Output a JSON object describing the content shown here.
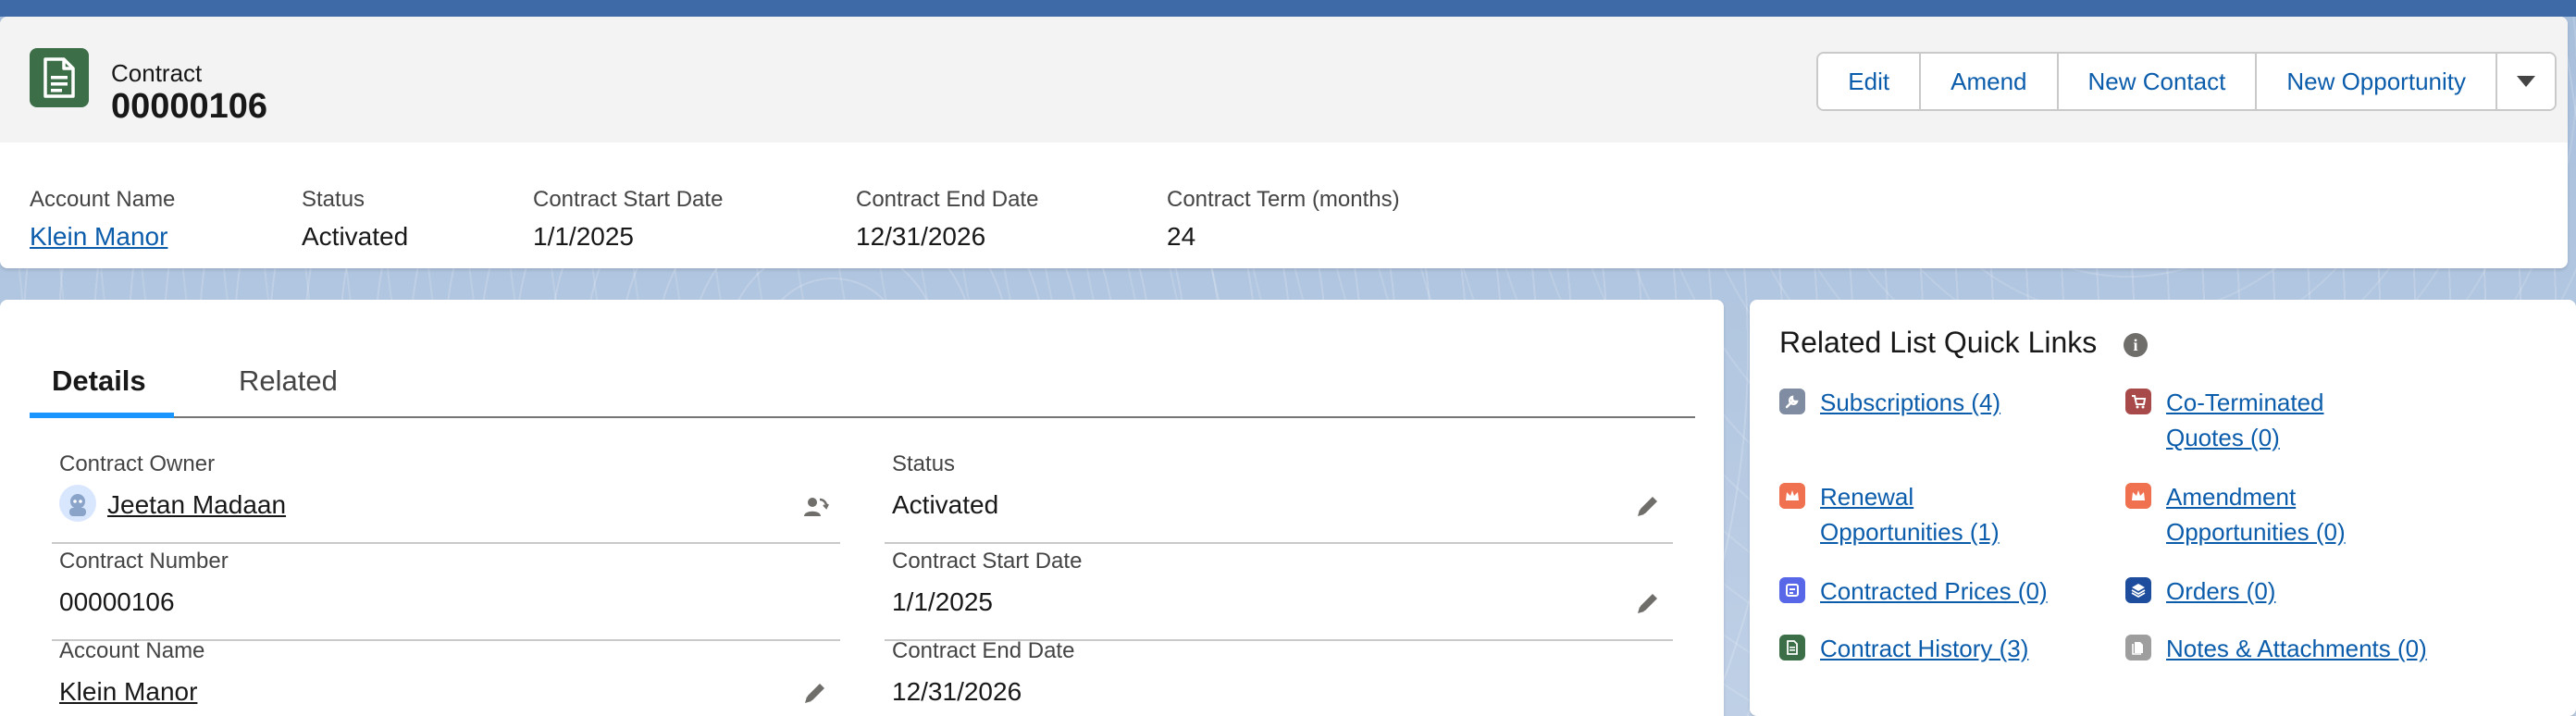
{
  "header": {
    "object_label": "Contract",
    "record_title": "00000106",
    "actions": {
      "edit": "Edit",
      "amend": "Amend",
      "new_contact": "New Contact",
      "new_opportunity": "New Opportunity"
    }
  },
  "highlights": [
    {
      "label": "Account Name",
      "value": "Klein Manor"
    },
    {
      "label": "Status",
      "value": "Activated"
    },
    {
      "label": "Contract Start Date",
      "value": "1/1/2025"
    },
    {
      "label": "Contract End Date",
      "value": "12/31/2026"
    },
    {
      "label": "Contract Term (months)",
      "value": "24"
    }
  ],
  "tabs": {
    "details": "Details",
    "related": "Related"
  },
  "details": {
    "contract_owner": {
      "label": "Contract Owner",
      "value": "Jeetan Madaan"
    },
    "status": {
      "label": "Status",
      "value": "Activated"
    },
    "contract_number": {
      "label": "Contract Number",
      "value": "00000106"
    },
    "start_date": {
      "label": "Contract Start Date",
      "value": "1/1/2025"
    },
    "account_name": {
      "label": "Account Name",
      "value": "Klein Manor"
    },
    "end_date": {
      "label": "Contract End Date",
      "value": "12/31/2026"
    }
  },
  "quick_links": {
    "title": "Related List Quick Links",
    "subscriptions": "Subscriptions (4)",
    "co_terminated_line1": "Co-Terminated",
    "co_terminated_line2": "Quotes (0)",
    "renewal_line1": "Renewal",
    "renewal_line2": "Opportunities (1)",
    "amendment_line1": "Amendment",
    "amendment_line2": "Opportunities (0)",
    "contracted_prices": "Contracted Prices (0)",
    "orders": "Orders (0)",
    "contract_history": "Contract History (3)",
    "notes_attachments": "Notes & Attachments (0)"
  },
  "colors": {
    "contract_icon": "#3c6e47",
    "link": "#0b5cab",
    "tab_active": "#1b96ff",
    "subscriptions_icon": "#7f8ca1",
    "co_terminated_icon": "#a94a4a",
    "renewal_icon": "#f0714f",
    "amendment_icon": "#f0714f",
    "contracted_prices_icon": "#5867e8",
    "orders_icon": "#1d4d9c",
    "contract_history_icon": "#3c6e47",
    "notes_icon": "#9e9e9e"
  },
  "icons": {
    "record": "contract-document-icon",
    "owner_change": "change-owner-icon",
    "edit": "pencil-icon",
    "info": "info-icon"
  }
}
